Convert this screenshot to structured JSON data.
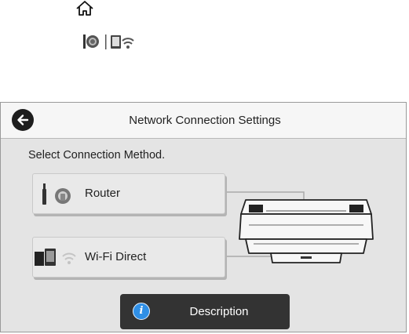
{
  "status_bar": {
    "home_icon": "home-icon",
    "network_icons": [
      "router-status-icon",
      "wifi-direct-status-icon"
    ]
  },
  "panel": {
    "title": "Network Connection Settings",
    "back_icon": "back-arrow-icon",
    "instruction": "Select Connection Method.",
    "methods": [
      {
        "label": "Router",
        "icon": "router-icon"
      },
      {
        "label": "Wi-Fi Direct",
        "icon": "wifi-direct-icon"
      }
    ],
    "description_button": {
      "label": "Description",
      "icon": "info-icon",
      "icon_glyph": "i"
    }
  },
  "colors": {
    "panel_bg": "#e4e4e4",
    "titlebar_bg": "#f6f6f6",
    "description_button_bg": "#333333",
    "info_icon_blue": "#2f8fe6"
  }
}
